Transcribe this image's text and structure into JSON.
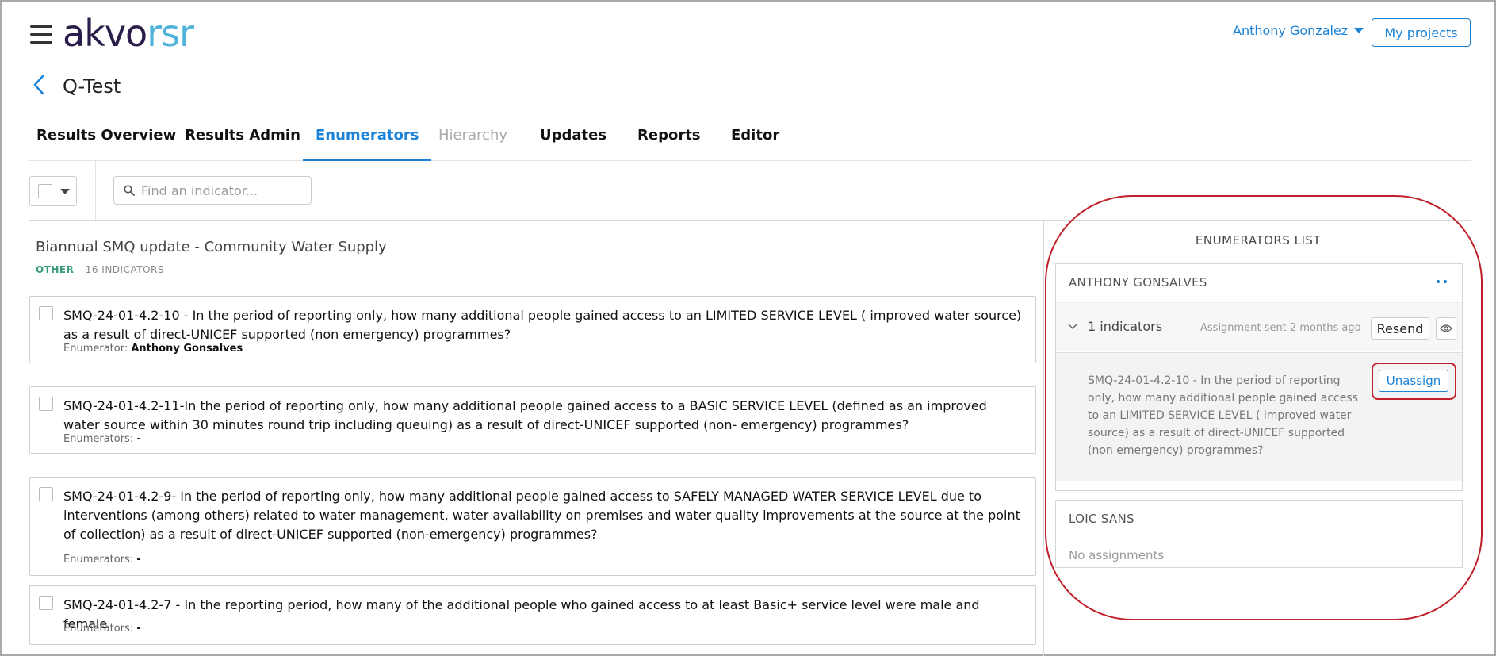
{
  "header": {
    "logo_part1": "akvo",
    "logo_part2": "rsr",
    "user_name": "Anthony Gonzalez",
    "my_projects_label": "My projects"
  },
  "project": {
    "title": "Q-Test"
  },
  "tabs": [
    {
      "label": "Results Overview",
      "state": "normal"
    },
    {
      "label": "Results Admin",
      "state": "normal"
    },
    {
      "label": "Enumerators",
      "state": "active"
    },
    {
      "label": "Hierarchy",
      "state": "disabled"
    },
    {
      "label": "Updates",
      "state": "normal"
    },
    {
      "label": "Reports",
      "state": "normal"
    },
    {
      "label": "Editor",
      "state": "normal"
    }
  ],
  "toolbar": {
    "search_placeholder": "Find an indicator..."
  },
  "result_group": {
    "title": "Biannual SMQ update - Community Water Supply",
    "type": "OTHER",
    "indicator_count": "16 INDICATORS"
  },
  "indicators": [
    {
      "text": "SMQ-24-01-4.2-10 - In the period of reporting only, how many additional people gained access to an LIMITED SERVICE LEVEL ( improved water source) as a result of direct-UNICEF supported (non emergency) programmes?",
      "enum_label": "Enumerator:",
      "enum_value": "Anthony Gonsalves"
    },
    {
      "text": "SMQ-24-01-4.2-11-In the period of reporting only, how many additional people gained access to a BASIC SERVICE LEVEL (defined as an improved water source within 30 minutes round trip including queuing) as a result of direct-UNICEF supported (non- emergency) programmes?",
      "enum_label": "Enumerators:",
      "enum_value": "-"
    },
    {
      "text": "SMQ-24-01-4.2-9- In the period of reporting only, how many additional people gained access to SAFELY MANAGED WATER SERVICE LEVEL due to interventions (among others) related to water management, water availability on premises and water quality improvements at the source at the point of collection) as a result of direct-UNICEF supported (non-emergency) programmes?",
      "enum_label": "Enumerators:",
      "enum_value": "-"
    },
    {
      "text": "SMQ-24-01-4.2-7 - In the reporting period, how many of the additional people who gained access to at least Basic+ service level were male and female",
      "enum_label": "Enumerators:",
      "enum_value": "-"
    }
  ],
  "enumerators_panel": {
    "title": "ENUMERATORS LIST",
    "enumerators": [
      {
        "name": "ANTHONY GONSALVES",
        "indicators_label": "1 indicators",
        "sent_text": "Assignment sent 2 months ago",
        "resend_label": "Resend",
        "assigned_text": "SMQ-24-01-4.2-10 - In the period of reporting only, how many additional people gained access to an LIMITED SERVICE LEVEL ( improved water source) as a result of direct-UNICEF supported (non emergency) programmes?",
        "unassign_label": "Unassign"
      },
      {
        "name": "LOIC SANS",
        "empty_text": "No assignments"
      }
    ]
  },
  "colors": {
    "accent": "#1a83d8",
    "logo_dark": "#2a1d4a",
    "logo_light": "#4fb3d9",
    "annotation_red": "#c0202a",
    "category_green": "#3a9b7a"
  },
  "icons": [
    "hamburger-icon",
    "caret-down-icon",
    "chevron-left-icon",
    "search-icon",
    "more-dots-icon",
    "chevron-down-icon",
    "eye-icon"
  ]
}
